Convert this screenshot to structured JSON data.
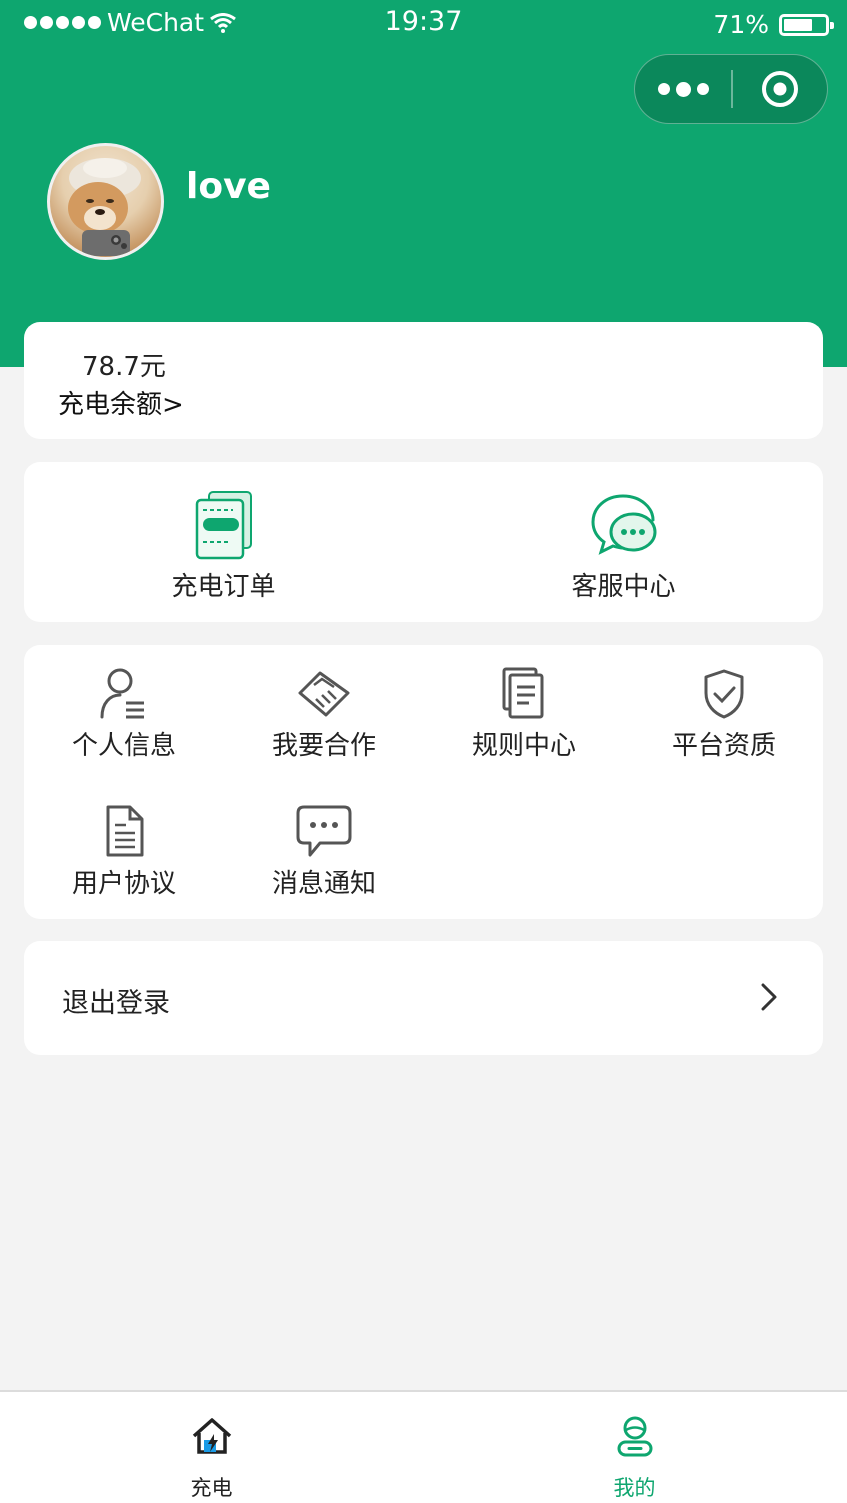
{
  "status_bar": {
    "carrier": "WeChat",
    "time": "19:37",
    "battery": "71%",
    "battery_level": 0.71
  },
  "capsule": {
    "more_icon": "more-dots-icon",
    "close_icon": "target-circle-icon"
  },
  "profile": {
    "username": "love",
    "avatar_icon": "avatar-shiba-dog"
  },
  "balance": {
    "amount": "78.7元",
    "label": "充电余额>"
  },
  "quick_actions": [
    {
      "label": "充电订单",
      "icon": "charging-order-icon"
    },
    {
      "label": "客服中心",
      "icon": "customer-service-chat-icon"
    }
  ],
  "menu_grid": [
    {
      "label": "个人信息",
      "icon": "user-info-icon"
    },
    {
      "label": "我要合作",
      "icon": "handshake-icon"
    },
    {
      "label": "规则中心",
      "icon": "rules-document-icon"
    },
    {
      "label": "平台资质",
      "icon": "shield-check-icon"
    },
    {
      "label": "用户协议",
      "icon": "file-text-icon"
    },
    {
      "label": "消息通知",
      "icon": "message-bubble-icon"
    }
  ],
  "logout": {
    "label": "退出登录",
    "arrow_icon": "chevron-right-icon"
  },
  "tabbar": {
    "items": [
      {
        "label": "充电",
        "icon": "home-charge-icon",
        "active": false
      },
      {
        "label": "我的",
        "icon": "user-profile-icon",
        "active": true
      }
    ]
  },
  "colors": {
    "brand_green": "#0ea66f",
    "page_bg": "#f3f3f3",
    "card_bg": "#ffffff",
    "icon_gray": "#555555"
  }
}
